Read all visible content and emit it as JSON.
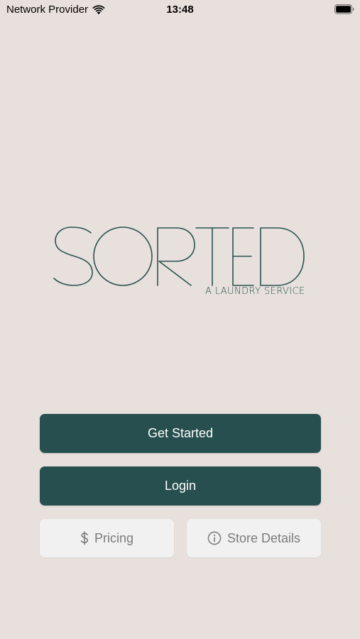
{
  "status_bar": {
    "carrier": "Network Provider",
    "time": "13:48"
  },
  "logo": {
    "wordmark": "SORTED",
    "tagline": "A LAUNDRY SERVICE",
    "color": "#2a5350"
  },
  "actions": {
    "get_started_label": "Get Started",
    "login_label": "Login",
    "pricing_label": "Pricing",
    "pricing_icon": "dollar-icon",
    "store_details_label": "Store Details",
    "store_details_icon": "info-icon"
  },
  "colors": {
    "background": "#e8e0dc",
    "primary": "#284f4f",
    "secondary_bg": "#f1f1f1",
    "secondary_text": "#7b7b7b"
  }
}
